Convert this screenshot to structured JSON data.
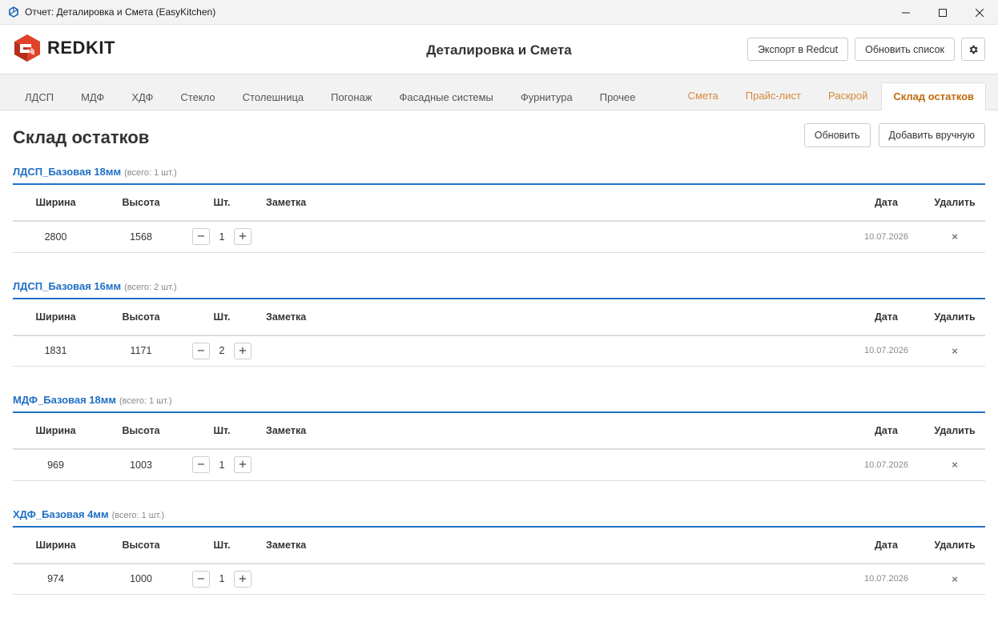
{
  "window": {
    "title": "Отчет: Деталировка и Смета (EasyKitchen)",
    "minimize_icon": "minimize-icon",
    "maximize_icon": "maximize-icon",
    "close_icon": "close-icon"
  },
  "header": {
    "logo_text": "REDKIT",
    "title": "Деталировка и Смета",
    "export_label": "Экспорт в Redcut",
    "refresh_list_label": "Обновить список",
    "settings_icon": "gear-icon"
  },
  "tabs": {
    "left": [
      {
        "label": "ЛДСП"
      },
      {
        "label": "МДФ"
      },
      {
        "label": "ХДФ"
      },
      {
        "label": "Стекло"
      },
      {
        "label": "Столешница"
      },
      {
        "label": "Погонаж"
      },
      {
        "label": "Фасадные системы"
      },
      {
        "label": "Фурнитура"
      },
      {
        "label": "Прочее"
      }
    ],
    "right": [
      {
        "label": "Смета"
      },
      {
        "label": "Прайс-лист"
      },
      {
        "label": "Раскрой"
      },
      {
        "label": "Склад остатков"
      }
    ],
    "active": "Склад остатков"
  },
  "page": {
    "title": "Склад остатков",
    "refresh_label": "Обновить",
    "add_manual_label": "Добавить вручную"
  },
  "columns": {
    "width": "Ширина",
    "height": "Высота",
    "qty": "Шт.",
    "note": "Заметка",
    "date": "Дата",
    "delete": "Удалить"
  },
  "groups": [
    {
      "name": "ЛДСП_Базовая 18мм",
      "count": "(всего: 1 шт.)",
      "rows": [
        {
          "width": "2800",
          "height": "1568",
          "qty": "1",
          "note": "",
          "date": "10.07.2026"
        }
      ]
    },
    {
      "name": "ЛДСП_Базовая 16мм",
      "count": "(всего: 2 шт.)",
      "rows": [
        {
          "width": "1831",
          "height": "1171",
          "qty": "2",
          "note": "",
          "date": "10.07.2026"
        }
      ]
    },
    {
      "name": "МДФ_Базовая 18мм",
      "count": "(всего: 1 шт.)",
      "rows": [
        {
          "width": "969",
          "height": "1003",
          "qty": "1",
          "note": "",
          "date": "10.07.2026"
        }
      ]
    },
    {
      "name": "ХДФ_Базовая 4мм",
      "count": "(всего: 1 шт.)",
      "rows": [
        {
          "width": "974",
          "height": "1000",
          "qty": "1",
          "note": "",
          "date": "10.07.2026"
        }
      ]
    }
  ],
  "controls": {
    "minus": "−",
    "plus": "+",
    "delete_icon": "×"
  },
  "colors": {
    "accent_blue": "#1f6fc5",
    "accent_orange": "#d4893a",
    "active_tab": "#c06b0f",
    "logo_red": "#e0412b"
  }
}
